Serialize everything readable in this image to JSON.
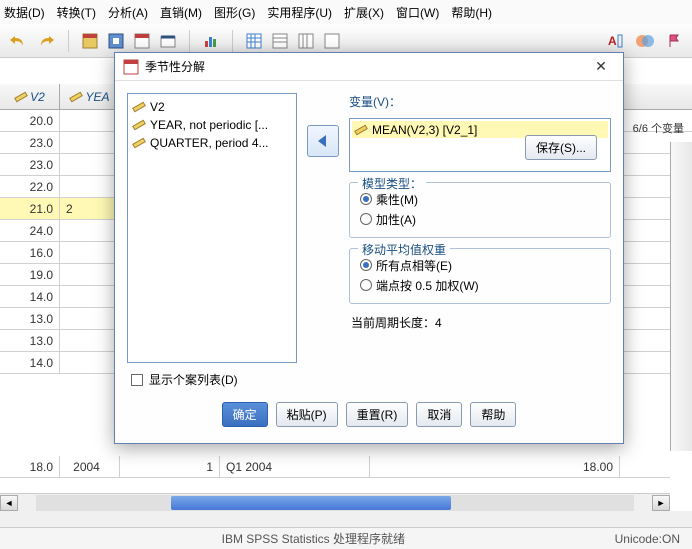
{
  "menu": {
    "items": [
      "数据(D)",
      "转换(T)",
      "分析(A)",
      "直销(M)",
      "图形(G)",
      "实用程序(U)",
      "扩展(X)",
      "窗口(W)",
      "帮助(H)"
    ]
  },
  "top_right": "6/6 个变量",
  "grid": {
    "headers": [
      "V2",
      "YEA"
    ],
    "widths": [
      60,
      60
    ],
    "rows": [
      {
        "v2": "20.0",
        "yea": ""
      },
      {
        "v2": "23.0",
        "yea": ""
      },
      {
        "v2": "23.0",
        "yea": ""
      },
      {
        "v2": "22.0",
        "yea": ""
      },
      {
        "v2": "21.0",
        "yea": "2",
        "hl": true
      },
      {
        "v2": "24.0",
        "yea": ""
      },
      {
        "v2": "16.0",
        "yea": ""
      },
      {
        "v2": "19.0",
        "yea": ""
      },
      {
        "v2": "14.0",
        "yea": ""
      },
      {
        "v2": "13.0",
        "yea": ""
      },
      {
        "v2": "13.0",
        "yea": ""
      },
      {
        "v2": "14.0",
        "yea": ""
      },
      {
        "v2": "18.0",
        "yea": "2004"
      }
    ],
    "tail": {
      "col3": "1",
      "col4": "Q1 2004",
      "col5": "18.00"
    }
  },
  "dialog": {
    "title": "季节性分解",
    "source_items": [
      "V2",
      "YEAR, not periodic [...",
      "QUARTER, period 4..."
    ],
    "var_label": "变量(V)：",
    "selected_var": "MEAN(V2,3) [V2_1]",
    "save_btn": "保存(S)...",
    "model_type": {
      "legend": "模型类型：",
      "opt1": "乘性(M)",
      "opt2": "加性(A)"
    },
    "ma_weight": {
      "legend": "移动平均值权重",
      "opt1": "所有点相等(E)",
      "opt2": "端点按 0.5 加权(W)"
    },
    "period": "当前周期长度：4",
    "show_cases": "显示个案列表(D)",
    "buttons": {
      "ok": "确定",
      "paste": "粘贴(P)",
      "reset": "重置(R)",
      "cancel": "取消",
      "help": "帮助"
    }
  },
  "statusbar": {
    "center": "IBM SPSS Statistics 处理程序就绪",
    "right": "Unicode:ON"
  }
}
